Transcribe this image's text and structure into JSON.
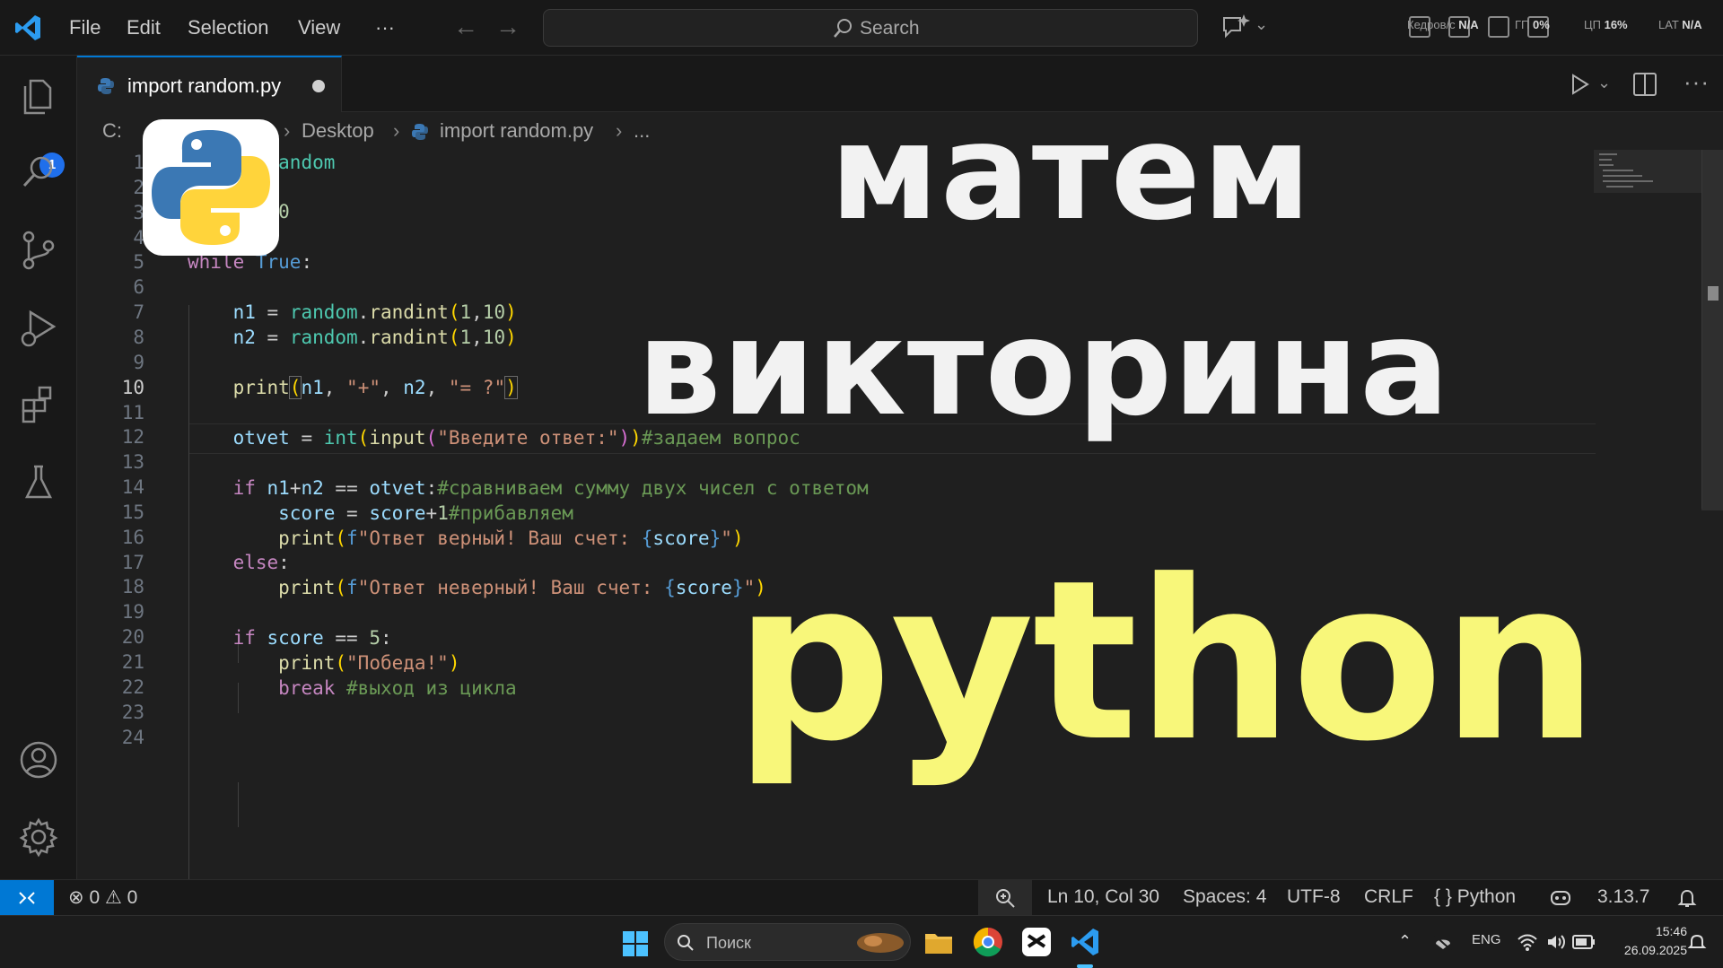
{
  "titlebar": {
    "menu": [
      "File",
      "Edit",
      "Selection",
      "View",
      "···"
    ],
    "search_label": "Search",
    "hw_stats": [
      {
        "label": "Кедров/с",
        "value": "N/A"
      },
      {
        "label": "ГП",
        "value": "0%"
      },
      {
        "label": "ЦП",
        "value": "16%"
      },
      {
        "label": "LAT",
        "value": "N/A"
      }
    ]
  },
  "activity": {
    "explorer_badge": "1"
  },
  "tab": {
    "label": "import random.py"
  },
  "breadcrumb": {
    "drive": "C:",
    "folder": "Desktop",
    "file": "import random.py",
    "more": "..."
  },
  "editor": {
    "line_numbers": [
      "1",
      "2",
      "3",
      "4",
      "5",
      "6",
      "7",
      "8",
      "9",
      "10",
      "11",
      "12",
      "13",
      "14",
      "15",
      "16",
      "17",
      "18",
      "19",
      "20",
      "21",
      "22",
      "23",
      "24"
    ],
    "active_line": "10"
  },
  "overlay": {
    "line1": "матем",
    "line2": "викторина",
    "line3": "python"
  },
  "statusbar": {
    "errors": "0",
    "warnings": "0",
    "position": "Ln 10, Col 30",
    "spaces": "Spaces: 4",
    "encoding": "UTF-8",
    "eol": "CRLF",
    "language": "Python",
    "python_version": "3.13.7"
  },
  "taskbar": {
    "search_label": "Поиск",
    "language": "ENG",
    "time": "15:46",
    "date": "26.09.2025"
  },
  "colors": {
    "accent": "#0078d4",
    "overlay_white": "#f2f2f2",
    "overlay_yellow": "#f8f77a"
  }
}
